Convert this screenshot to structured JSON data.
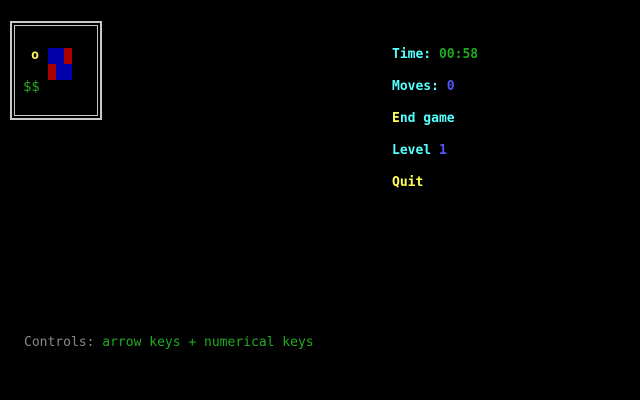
{
  "board": {
    "player_glyph": "o",
    "treasure_glyph": "$$",
    "colors": {
      "frame": "#c8c8c8",
      "player": "#ffff55",
      "treasure": "#22aa22",
      "block_blue": "#0000aa",
      "block_red": "#aa0000"
    }
  },
  "status": {
    "time_label": "Time:",
    "time_value": "00:58",
    "moves_label": "Moves:",
    "moves_value": "0",
    "end_game_label": "End game",
    "level_label": "Level",
    "level_value": "1",
    "quit_label": "Quit",
    "colors": {
      "label": "#55ffff",
      "time_value": "#22aa22",
      "moves_value": "#5555ff",
      "level_value": "#5555ff",
      "action": "#ffff55"
    }
  },
  "footer": {
    "controls_label": "Controls:",
    "controls_value": "arrow keys + numerical keys",
    "colors": {
      "label": "#888888",
      "value": "#22aa22"
    }
  }
}
